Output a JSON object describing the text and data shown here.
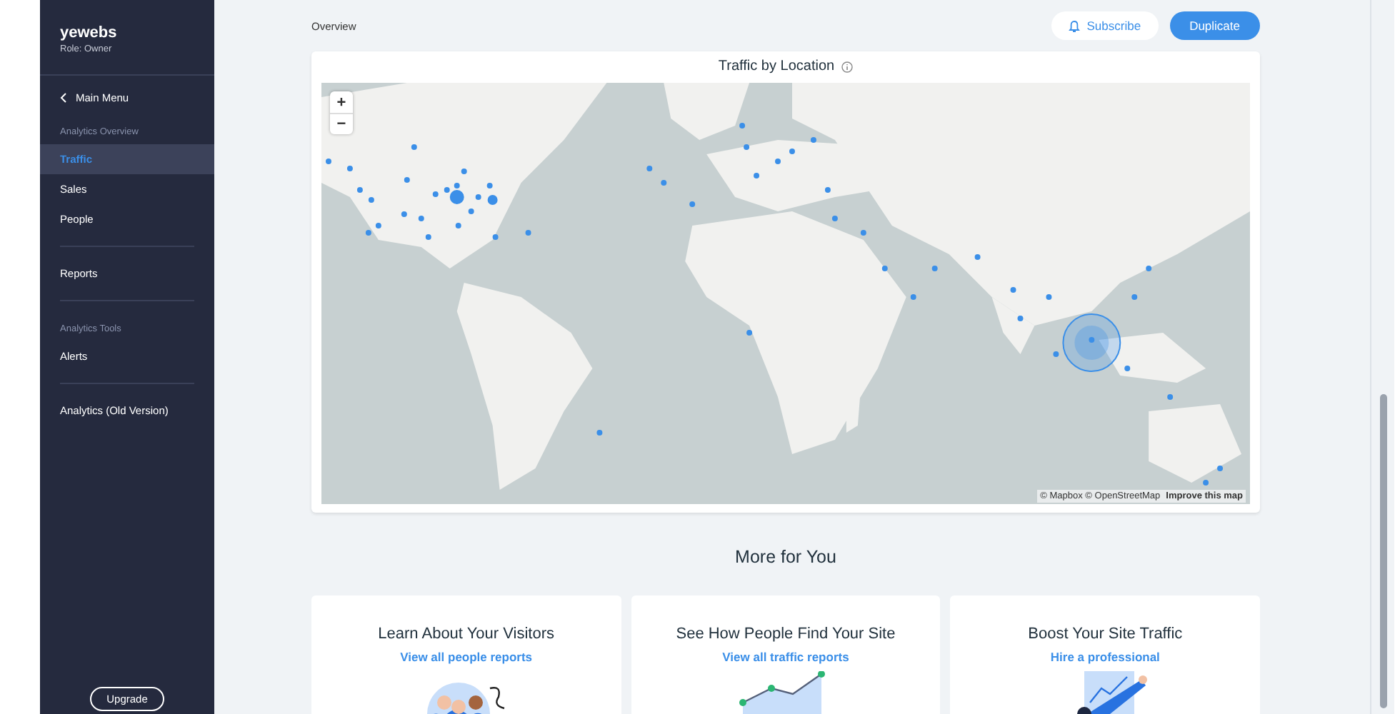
{
  "sidebar": {
    "site_name": "yewebs",
    "role": "Role: Owner",
    "back_link": "Main Menu",
    "groups": [
      {
        "heading": "Analytics Overview",
        "items": [
          {
            "label": "Traffic",
            "selected": true
          },
          {
            "label": "Sales",
            "selected": false
          },
          {
            "label": "People",
            "selected": false
          }
        ]
      },
      {
        "items": [
          {
            "label": "Reports",
            "selected": false
          }
        ]
      },
      {
        "heading": "Analytics Tools",
        "items": [
          {
            "label": "Alerts",
            "selected": false
          }
        ]
      },
      {
        "items": [
          {
            "label": "Analytics (Old Version)",
            "selected": false
          }
        ]
      }
    ],
    "upgrade_button": "Upgrade"
  },
  "header": {
    "breadcrumb": "Overview",
    "subscribe_button": "Subscribe",
    "duplicate_button": "Duplicate"
  },
  "map_card": {
    "title": "Traffic by Location",
    "zoom_in": "+",
    "zoom_out": "−",
    "attribution": "© Mapbox © OpenStreetMap",
    "improve_link": "Improve this map"
  },
  "more_section": {
    "title": "More for You",
    "cards": [
      {
        "kind": "people",
        "title": "Learn About Your Visitors",
        "link": "View all people reports"
      },
      {
        "kind": "chart",
        "title": "See How People Find Your Site",
        "link": "View all traffic reports"
      },
      {
        "kind": "pointing",
        "title": "Boost Your Site Traffic",
        "link": "Hire a professional"
      }
    ]
  }
}
